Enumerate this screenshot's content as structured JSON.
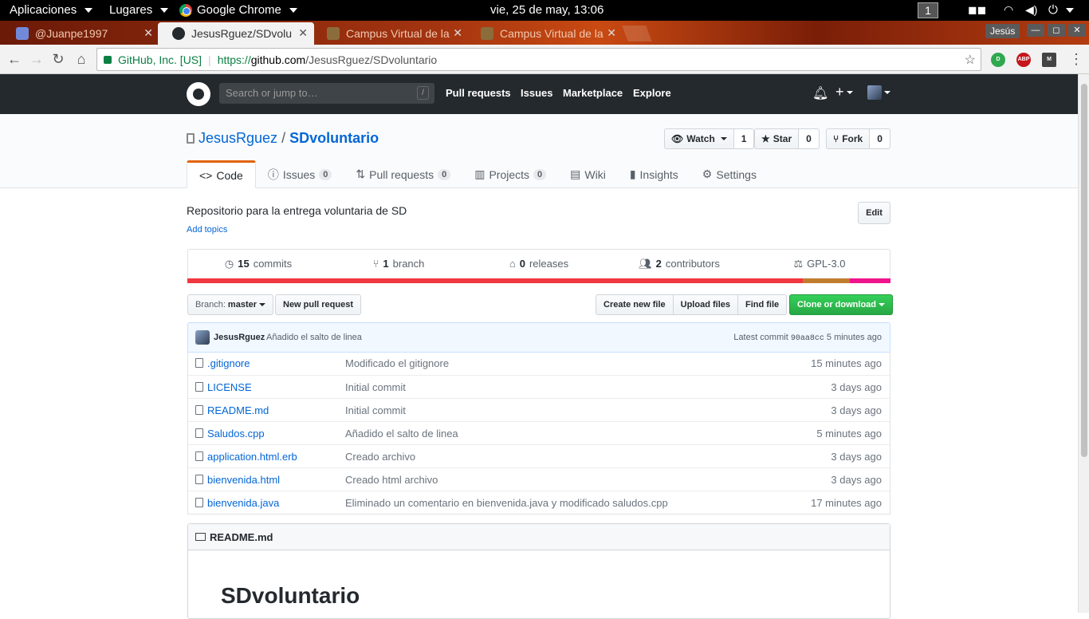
{
  "gnome": {
    "applications": "Aplicaciones",
    "places": "Lugares",
    "app": "Google Chrome",
    "clock": "vie, 25 de may, 13:06",
    "workspace": "1"
  },
  "tabs": [
    {
      "title": "@Juanpe1997",
      "icon": "discord-icon",
      "color": "#7289da"
    },
    {
      "title": "JesusRguez/SDvolu",
      "icon": "github-icon",
      "color": "#24292e"
    },
    {
      "title": "Campus Virtual de la",
      "icon": "campus-icon",
      "color": "#8a6d3b"
    },
    {
      "title": "Campus Virtual de la",
      "icon": "campus-icon",
      "color": "#8a6d3b"
    }
  ],
  "window": {
    "user": "Jesús"
  },
  "address": {
    "secure_label": "GitHub, Inc. [US]",
    "scheme": "https://",
    "host": "github.com",
    "path": "/JesusRguez/SDvoluntario"
  },
  "github": {
    "search_placeholder": "Search or jump to…",
    "search_key": "/",
    "nav": [
      "Pull requests",
      "Issues",
      "Marketplace",
      "Explore"
    ]
  },
  "repo": {
    "owner": "JesusRguez",
    "name": "SDvoluntario",
    "watch_label": "Watch",
    "watch_count": "1",
    "star_label": "Star",
    "star_count": "0",
    "fork_label": "Fork",
    "fork_count": "0",
    "tabs": [
      {
        "label": "Code",
        "counter": ""
      },
      {
        "label": "Issues",
        "counter": "0"
      },
      {
        "label": "Pull requests",
        "counter": "0"
      },
      {
        "label": "Projects",
        "counter": "0"
      },
      {
        "label": "Wiki",
        "counter": ""
      },
      {
        "label": "Insights",
        "counter": ""
      },
      {
        "label": "Settings",
        "counter": ""
      }
    ],
    "description": "Repositorio para la entrega voluntaria de SD",
    "add_topics": "Add topics",
    "edit": "Edit",
    "stats": {
      "commits_num": "15",
      "commits_label": "commits",
      "branch_num": "1",
      "branch_label": "branch",
      "releases_num": "0",
      "releases_label": "releases",
      "contributors_num": "2",
      "contributors_label": "contributors",
      "license": "GPL-3.0"
    },
    "languages": [
      {
        "color": "#f1373f",
        "share": 0.875
      },
      {
        "color": "#c07d2f",
        "share": 0.067
      },
      {
        "color": "#f0148c",
        "share": 0.058
      }
    ],
    "branch_prefix": "Branch:",
    "branch": "master",
    "new_pr": "New pull request",
    "create_file": "Create new file",
    "upload_files": "Upload files",
    "find_file": "Find file",
    "clone": "Clone or download",
    "latest_commit": {
      "author": "JesusRguez",
      "message": "Añadido el salto de linea",
      "prefix": "Latest commit",
      "sha": "90aa8cc",
      "age": "5 minutes ago"
    },
    "files": [
      {
        "name": ".gitignore",
        "message": "Modificado el gitignore",
        "age": "15 minutes ago"
      },
      {
        "name": "LICENSE",
        "message": "Initial commit",
        "age": "3 days ago"
      },
      {
        "name": "README.md",
        "message": "Initial commit",
        "age": "3 days ago"
      },
      {
        "name": "Saludos.cpp",
        "message": "Añadido el salto de linea",
        "age": "5 minutes ago"
      },
      {
        "name": "application.html.erb",
        "message": "Creado archivo",
        "age": "3 days ago"
      },
      {
        "name": "bienvenida.html",
        "message": "Creado html archivo",
        "age": "3 days ago"
      },
      {
        "name": "bienvenida.java",
        "message": "Eliminado un comentario en bienvenida.java y modificado saludos.cpp",
        "age": "17 minutes ago"
      }
    ],
    "readme_file": "README.md",
    "readme_title": "SDvoluntario"
  }
}
